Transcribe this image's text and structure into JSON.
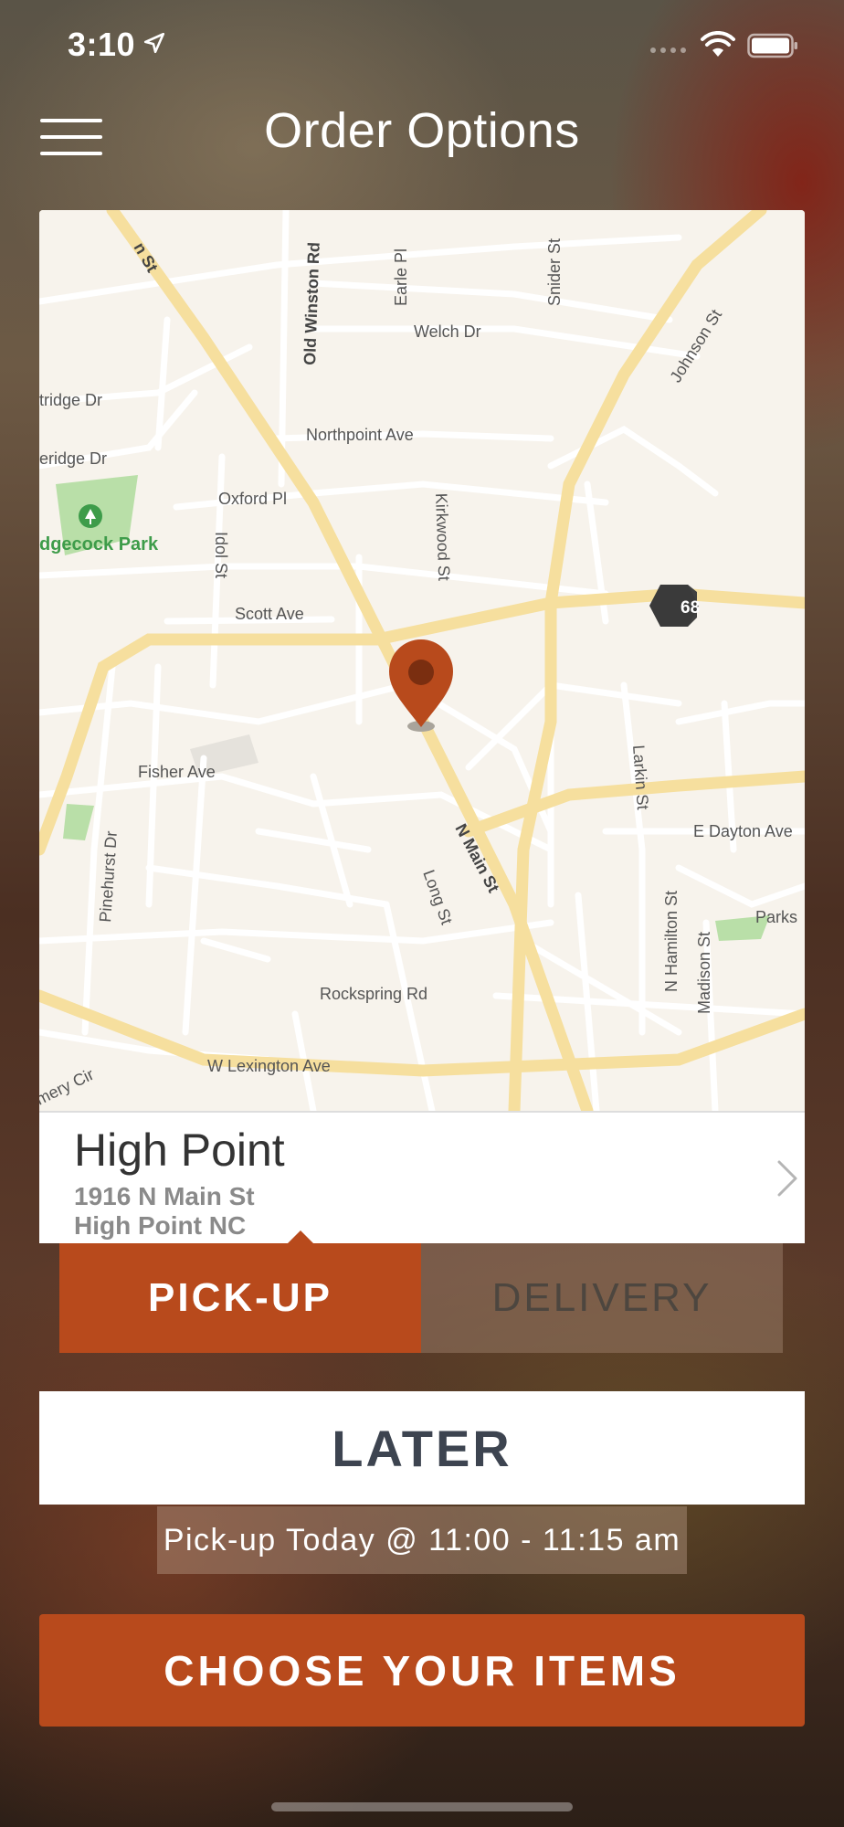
{
  "status_bar": {
    "time": "3:10"
  },
  "header": {
    "title": "Order Options",
    "menu_icon": "hamburger-menu-icon"
  },
  "map": {
    "labels": {
      "n_main_st_top": "n St",
      "old_winston_rd": "Old Winston Rd",
      "earle_pl": "Earle Pl",
      "snider_st": "Snider St",
      "welch_dr": "Welch Dr",
      "johnson_st": "Johnson St",
      "tridge_dr": "tridge Dr",
      "eridge_dr": "eridge Dr",
      "northpoint_ave": "Northpoint Ave",
      "oxford_pl": "Oxford Pl",
      "kirkwood_st": "Kirkwood St",
      "idol_st": "Idol St",
      "park": "dgecock Park",
      "scott_ave": "Scott Ave",
      "route_68": "68",
      "fisher_ave": "Fisher Ave",
      "larkin_st": "Larkin St",
      "e_dayton_ave": "E Dayton Ave",
      "pinehurst_dr": "Pinehurst Dr",
      "n_main_st": "N Main St",
      "long_st": "Long St",
      "n_hamilton_st": "N Hamilton St",
      "madison_st": "Madison St",
      "parks": "Parks",
      "rockspring_rd": "Rockspring Rd",
      "w_lexington_ave": "W Lexington Ave",
      "emery_cir": "mery Cir"
    },
    "pin_color": "#b84a1c"
  },
  "location": {
    "name": "High Point",
    "address_line1": "1916 N Main St",
    "address_line2": "High Point NC"
  },
  "order_mode": {
    "pickup_label": "PICK-UP",
    "delivery_label": "DELIVERY",
    "selected": "pickup"
  },
  "timing": {
    "later_label": "LATER",
    "pickup_time_label": "Pick-up Today @ 11:00 - 11:15 am"
  },
  "cta": {
    "choose_label": "CHOOSE YOUR ITEMS"
  },
  "colors": {
    "accent": "#b84a1c",
    "dark_text": "#3d4450"
  }
}
